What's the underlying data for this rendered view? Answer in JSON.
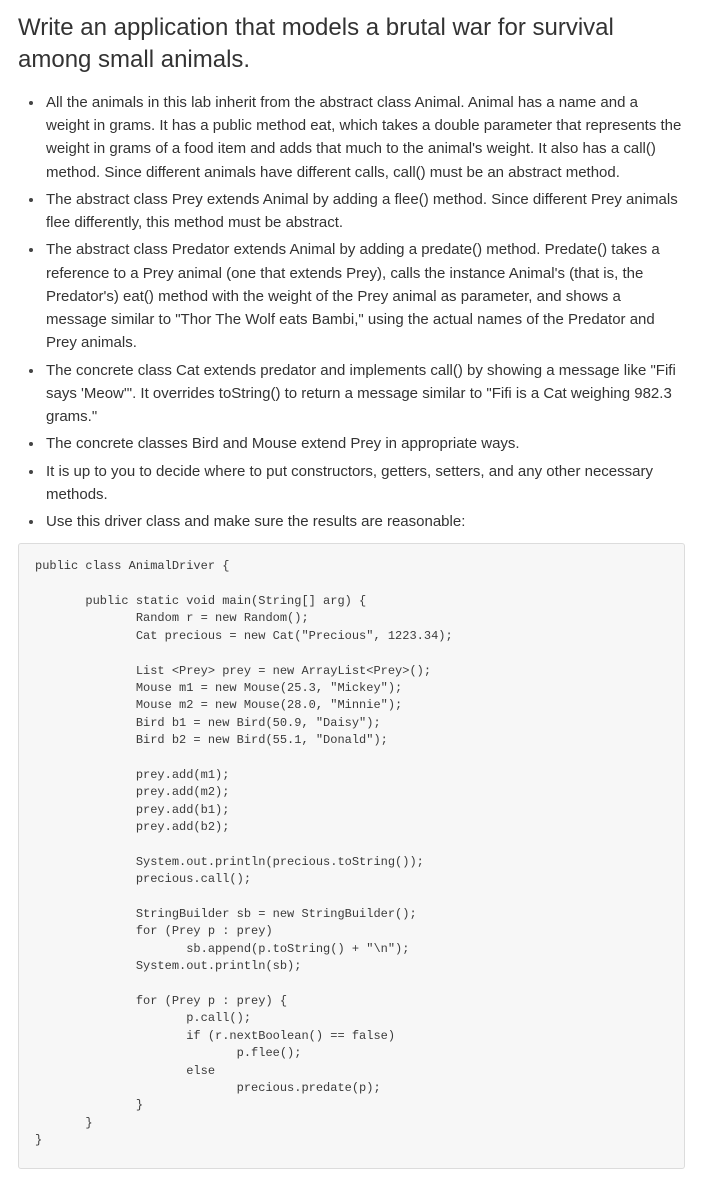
{
  "heading": "Write an application that models a brutal war for survival among small animals.",
  "bullets": [
    "All the animals in this lab inherit from the abstract class Animal. Animal has a name and a weight in grams. It has a public method eat, which takes a double parameter that represents the weight in grams of a food item and adds that much to the animal's weight. It also has a call() method. Since different animals have different calls, call() must be an abstract method.",
    "The abstract class Prey extends Animal by adding a flee() method. Since different Prey animals flee differently, this method must be abstract.",
    "The abstract class Predator extends Animal by adding a predate() method. Predate() takes a reference to a Prey animal (one that extends Prey), calls the instance Animal's (that is, the Predator's) eat() method with the weight of the Prey animal as parameter, and shows a message similar to \"Thor The Wolf eats Bambi,\" using the actual names of the Predator and Prey animals.",
    "The concrete class Cat extends predator and implements call() by showing a message like \"Fifi says 'Meow'\". It overrides toString() to return a message similar to \"Fifi is a Cat weighing 982.3 grams.\"",
    "The concrete classes Bird and Mouse extend Prey in appropriate ways.",
    "It is up to you to decide where to put constructors, getters, setters, and any other necessary methods.",
    "Use this driver class and make sure the results are reasonable:"
  ],
  "code": "public class AnimalDriver {\n\n       public static void main(String[] arg) {\n              Random r = new Random();\n              Cat precious = new Cat(\"Precious\", 1223.34);\n\n              List <Prey> prey = new ArrayList<Prey>();\n              Mouse m1 = new Mouse(25.3, \"Mickey\");\n              Mouse m2 = new Mouse(28.0, \"Minnie\");\n              Bird b1 = new Bird(50.9, \"Daisy\");\n              Bird b2 = new Bird(55.1, \"Donald\");\n\n              prey.add(m1);\n              prey.add(m2);\n              prey.add(b1);\n              prey.add(b2);\n\n              System.out.println(precious.toString());\n              precious.call();\n\n              StringBuilder sb = new StringBuilder();\n              for (Prey p : prey)\n                     sb.append(p.toString() + \"\\n\");\n              System.out.println(sb);\n\n              for (Prey p : prey) {\n                     p.call();\n                     if (r.nextBoolean() == false)\n                            p.flee();\n                     else\n                            precious.predate(p);\n              }\n       }\n}"
}
